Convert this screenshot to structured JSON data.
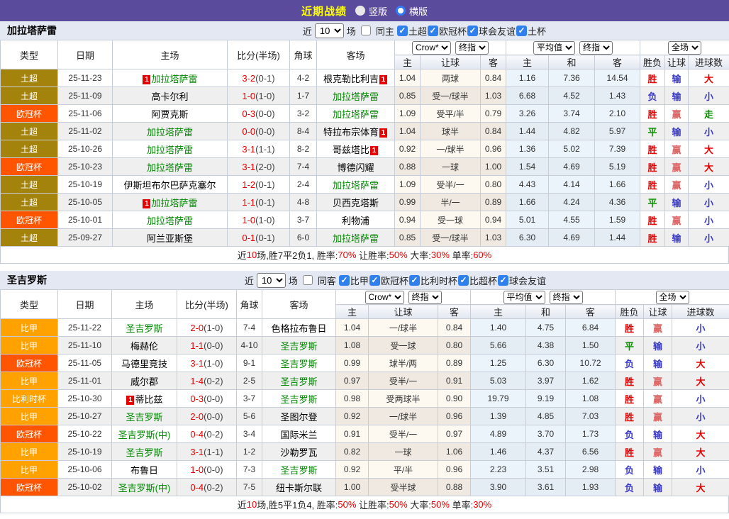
{
  "titlebar": {
    "title": "近期战绩",
    "radio_vertical": "竖版",
    "radio_horizontal": "横版"
  },
  "columns": [
    "类型",
    "日期",
    "主场",
    "比分(半场)",
    "角球",
    "客场"
  ],
  "odds_headers": [
    "主",
    "让球",
    "客"
  ],
  "avg_headers": [
    "主",
    "和",
    "客"
  ],
  "result_headers": [
    "胜负",
    "让球",
    "进球数"
  ],
  "dropdowns": {
    "company": "Crow*",
    "final1": "终指",
    "average": "平均值",
    "final2": "终指",
    "scope": "全场"
  },
  "colors": {
    "type": {
      "土超": "#a3830b",
      "欧冠杯": "#ff5500",
      "比甲": "#ffa200",
      "比利时杯": "#ffa200"
    },
    "result": {
      "胜": "#e60000",
      "平": "#089000",
      "负": "#3a3ac6",
      "赢": "#dd6666",
      "输": "#3a3ac6",
      "大": "#e60000",
      "小": "#3a3ac6",
      "走": "#089000"
    },
    "accent_red": "#e60000",
    "green_team": "#008800",
    "titlebar_purple": "#5a4b9d"
  },
  "sections": [
    {
      "team": "加拉塔萨雷",
      "filter": {
        "near": "近",
        "count": "10",
        "games": "场",
        "same": "同主",
        "same_checked": false,
        "leagues": [
          "土超",
          "欧冠杯",
          "球会友谊",
          "土杯"
        ]
      },
      "rows": [
        {
          "type": "土超",
          "date": "25-11-23",
          "home": "加拉塔萨雷",
          "home_green": true,
          "home_card": "left",
          "score": "3-2",
          "half": "(0-1)",
          "corner": "4-2",
          "away": "根克勒比利吉",
          "away_green": false,
          "away_card": "right",
          "odds": [
            "1.04",
            "两球",
            "0.84"
          ],
          "avg": [
            "1.16",
            "7.36",
            "14.54"
          ],
          "results": [
            "胜",
            "输",
            "大"
          ]
        },
        {
          "type": "土超",
          "date": "25-11-09",
          "home": "高卡尔利",
          "home_green": false,
          "home_card": "",
          "score": "1-0",
          "half": "(1-0)",
          "corner": "1-7",
          "away": "加拉塔萨雷",
          "away_green": true,
          "away_card": "",
          "odds": [
            "0.85",
            "受一/球半",
            "1.03"
          ],
          "avg": [
            "6.68",
            "4.52",
            "1.43"
          ],
          "results": [
            "负",
            "输",
            "小"
          ]
        },
        {
          "type": "欧冠杯",
          "date": "25-11-06",
          "home": "阿贾克斯",
          "home_green": false,
          "home_card": "",
          "score": "0-3",
          "half": "(0-0)",
          "corner": "3-2",
          "away": "加拉塔萨雷",
          "away_green": true,
          "away_card": "",
          "odds": [
            "1.09",
            "受平/半",
            "0.79"
          ],
          "avg": [
            "3.26",
            "3.74",
            "2.10"
          ],
          "results": [
            "胜",
            "赢",
            "走"
          ]
        },
        {
          "type": "土超",
          "date": "25-11-02",
          "home": "加拉塔萨雷",
          "home_green": true,
          "home_card": "",
          "score": "0-0",
          "half": "(0-0)",
          "corner": "8-4",
          "away": "特拉布宗体育",
          "away_green": false,
          "away_card": "right",
          "odds": [
            "1.04",
            "球半",
            "0.84"
          ],
          "avg": [
            "1.44",
            "4.82",
            "5.97"
          ],
          "results": [
            "平",
            "输",
            "小"
          ]
        },
        {
          "type": "土超",
          "date": "25-10-26",
          "home": "加拉塔萨雷",
          "home_green": true,
          "home_card": "",
          "score": "3-1",
          "half": "(1-1)",
          "corner": "8-2",
          "away": "哥兹塔比",
          "away_green": false,
          "away_card": "right",
          "odds": [
            "0.92",
            "一/球半",
            "0.96"
          ],
          "avg": [
            "1.36",
            "5.02",
            "7.39"
          ],
          "results": [
            "胜",
            "赢",
            "大"
          ]
        },
        {
          "type": "欧冠杯",
          "date": "25-10-23",
          "home": "加拉塔萨雷",
          "home_green": true,
          "home_card": "",
          "score": "3-1",
          "half": "(2-0)",
          "corner": "7-4",
          "away": "博德闪耀",
          "away_green": false,
          "away_card": "",
          "odds": [
            "0.88",
            "一球",
            "1.00"
          ],
          "avg": [
            "1.54",
            "4.69",
            "5.19"
          ],
          "results": [
            "胜",
            "赢",
            "大"
          ]
        },
        {
          "type": "土超",
          "date": "25-10-19",
          "home": "伊斯坦布尔巴萨克塞尔",
          "home_green": false,
          "home_card": "",
          "score": "1-2",
          "half": "(0-1)",
          "corner": "2-4",
          "away": "加拉塔萨雷",
          "away_green": true,
          "away_card": "",
          "odds": [
            "1.09",
            "受半/一",
            "0.80"
          ],
          "avg": [
            "4.43",
            "4.14",
            "1.66"
          ],
          "results": [
            "胜",
            "赢",
            "小"
          ]
        },
        {
          "type": "土超",
          "date": "25-10-05",
          "home": "加拉塔萨雷",
          "home_green": true,
          "home_card": "left",
          "score": "1-1",
          "half": "(0-1)",
          "corner": "4-8",
          "away": "贝西克塔斯",
          "away_green": false,
          "away_card": "",
          "odds": [
            "0.99",
            "半/一",
            "0.89"
          ],
          "avg": [
            "1.66",
            "4.24",
            "4.36"
          ],
          "results": [
            "平",
            "输",
            "小"
          ]
        },
        {
          "type": "欧冠杯",
          "date": "25-10-01",
          "home": "加拉塔萨雷",
          "home_green": true,
          "home_card": "",
          "score": "1-0",
          "half": "(1-0)",
          "corner": "3-7",
          "away": "利物浦",
          "away_green": false,
          "away_card": "",
          "odds": [
            "0.94",
            "受一球",
            "0.94"
          ],
          "avg": [
            "5.01",
            "4.55",
            "1.59"
          ],
          "results": [
            "胜",
            "赢",
            "小"
          ]
        },
        {
          "type": "土超",
          "date": "25-09-27",
          "home": "阿兰亚斯堡",
          "home_green": false,
          "home_card": "",
          "score": "0-1",
          "half": "(0-1)",
          "corner": "6-0",
          "away": "加拉塔萨雷",
          "away_green": true,
          "away_card": "",
          "odds": [
            "0.85",
            "受一/球半",
            "1.03"
          ],
          "avg": [
            "6.30",
            "4.69",
            "1.44"
          ],
          "results": [
            "胜",
            "输",
            "小"
          ]
        }
      ],
      "summary": [
        {
          "t": "近",
          "r": false
        },
        {
          "t": "10",
          "r": true
        },
        {
          "t": "场,胜7平2负1, 胜率:",
          "r": false
        },
        {
          "t": "70%",
          "r": true
        },
        {
          "t": " 让胜率:",
          "r": false
        },
        {
          "t": "50%",
          "r": true
        },
        {
          "t": " 大率:",
          "r": false
        },
        {
          "t": "30%",
          "r": true
        },
        {
          "t": " 单率:",
          "r": false
        },
        {
          "t": "60%",
          "r": true
        }
      ]
    },
    {
      "team": "圣吉罗斯",
      "filter": {
        "near": "近",
        "count": "10",
        "games": "场",
        "same": "同客",
        "same_checked": false,
        "leagues": [
          "比甲",
          "欧冠杯",
          "比利时杯",
          "比超杯",
          "球会友谊"
        ]
      },
      "rows": [
        {
          "type": "比甲",
          "date": "25-11-22",
          "home": "圣吉罗斯",
          "home_green": true,
          "home_card": "",
          "score": "2-0",
          "half": "(1-0)",
          "corner": "7-4",
          "away": "色格拉布鲁日",
          "away_green": false,
          "away_card": "",
          "odds": [
            "1.04",
            "一/球半",
            "0.84"
          ],
          "avg": [
            "1.40",
            "4.75",
            "6.84"
          ],
          "results": [
            "胜",
            "赢",
            "小"
          ]
        },
        {
          "type": "比甲",
          "date": "25-11-10",
          "home": "梅赫伦",
          "home_green": false,
          "home_card": "",
          "score": "1-1",
          "half": "(0-0)",
          "corner": "4-10",
          "away": "圣吉罗斯",
          "away_green": true,
          "away_card": "",
          "odds": [
            "1.08",
            "受一球",
            "0.80"
          ],
          "avg": [
            "5.66",
            "4.38",
            "1.50"
          ],
          "results": [
            "平",
            "输",
            "小"
          ]
        },
        {
          "type": "欧冠杯",
          "date": "25-11-05",
          "home": "马德里竞技",
          "home_green": false,
          "home_card": "",
          "score": "3-1",
          "half": "(1-0)",
          "corner": "9-1",
          "away": "圣吉罗斯",
          "away_green": true,
          "away_card": "",
          "odds": [
            "0.99",
            "球半/两",
            "0.89"
          ],
          "avg": [
            "1.25",
            "6.30",
            "10.72"
          ],
          "results": [
            "负",
            "输",
            "大"
          ]
        },
        {
          "type": "比甲",
          "date": "25-11-01",
          "home": "威尔郡",
          "home_green": false,
          "home_card": "",
          "score": "1-4",
          "half": "(0-2)",
          "corner": "2-5",
          "away": "圣吉罗斯",
          "away_green": true,
          "away_card": "",
          "odds": [
            "0.97",
            "受半/一",
            "0.91"
          ],
          "avg": [
            "5.03",
            "3.97",
            "1.62"
          ],
          "results": [
            "胜",
            "赢",
            "大"
          ]
        },
        {
          "type": "比利时杯",
          "date": "25-10-30",
          "home": "蒂比兹",
          "home_green": false,
          "home_card": "left",
          "score": "0-3",
          "half": "(0-0)",
          "corner": "3-7",
          "away": "圣吉罗斯",
          "away_green": true,
          "away_card": "",
          "odds": [
            "0.98",
            "受两球半",
            "0.90"
          ],
          "avg": [
            "19.79",
            "9.19",
            "1.08"
          ],
          "results": [
            "胜",
            "赢",
            "小"
          ]
        },
        {
          "type": "比甲",
          "date": "25-10-27",
          "home": "圣吉罗斯",
          "home_green": true,
          "home_card": "",
          "score": "2-0",
          "half": "(0-0)",
          "corner": "5-6",
          "away": "圣图尔登",
          "away_green": false,
          "away_card": "",
          "odds": [
            "0.92",
            "一/球半",
            "0.96"
          ],
          "avg": [
            "1.39",
            "4.85",
            "7.03"
          ],
          "results": [
            "胜",
            "赢",
            "小"
          ]
        },
        {
          "type": "欧冠杯",
          "date": "25-10-22",
          "home": "圣吉罗斯(中)",
          "home_green": true,
          "home_card": "",
          "score": "0-4",
          "half": "(0-2)",
          "corner": "3-4",
          "away": "国际米兰",
          "away_green": false,
          "away_card": "",
          "odds": [
            "0.91",
            "受半/一",
            "0.97"
          ],
          "avg": [
            "4.89",
            "3.70",
            "1.73"
          ],
          "results": [
            "负",
            "输",
            "大"
          ]
        },
        {
          "type": "比甲",
          "date": "25-10-19",
          "home": "圣吉罗斯",
          "home_green": true,
          "home_card": "",
          "score": "3-1",
          "half": "(1-1)",
          "corner": "1-2",
          "away": "沙勒罗瓦",
          "away_green": false,
          "away_card": "",
          "odds": [
            "0.82",
            "一球",
            "1.06"
          ],
          "avg": [
            "1.46",
            "4.37",
            "6.56"
          ],
          "results": [
            "胜",
            "赢",
            "大"
          ]
        },
        {
          "type": "比甲",
          "date": "25-10-06",
          "home": "布鲁日",
          "home_green": false,
          "home_card": "",
          "score": "1-0",
          "half": "(0-0)",
          "corner": "7-3",
          "away": "圣吉罗斯",
          "away_green": true,
          "away_card": "",
          "odds": [
            "0.92",
            "平/半",
            "0.96"
          ],
          "avg": [
            "2.23",
            "3.51",
            "2.98"
          ],
          "results": [
            "负",
            "输",
            "小"
          ]
        },
        {
          "type": "欧冠杯",
          "date": "25-10-02",
          "home": "圣吉罗斯(中)",
          "home_green": true,
          "home_card": "",
          "score": "0-4",
          "half": "(0-2)",
          "corner": "7-5",
          "away": "纽卡斯尔联",
          "away_green": false,
          "away_card": "",
          "odds": [
            "1.00",
            "受半球",
            "0.88"
          ],
          "avg": [
            "3.90",
            "3.61",
            "1.93"
          ],
          "results": [
            "负",
            "输",
            "大"
          ]
        }
      ],
      "summary": [
        {
          "t": "近",
          "r": false
        },
        {
          "t": "10",
          "r": true
        },
        {
          "t": "场,胜5平1负4, 胜率:",
          "r": false
        },
        {
          "t": "50%",
          "r": true
        },
        {
          "t": " 让胜率:",
          "r": false
        },
        {
          "t": "50%",
          "r": true
        },
        {
          "t": " 大率:",
          "r": false
        },
        {
          "t": "50%",
          "r": true
        },
        {
          "t": " 单率:",
          "r": false
        },
        {
          "t": "30%",
          "r": true
        }
      ]
    }
  ]
}
